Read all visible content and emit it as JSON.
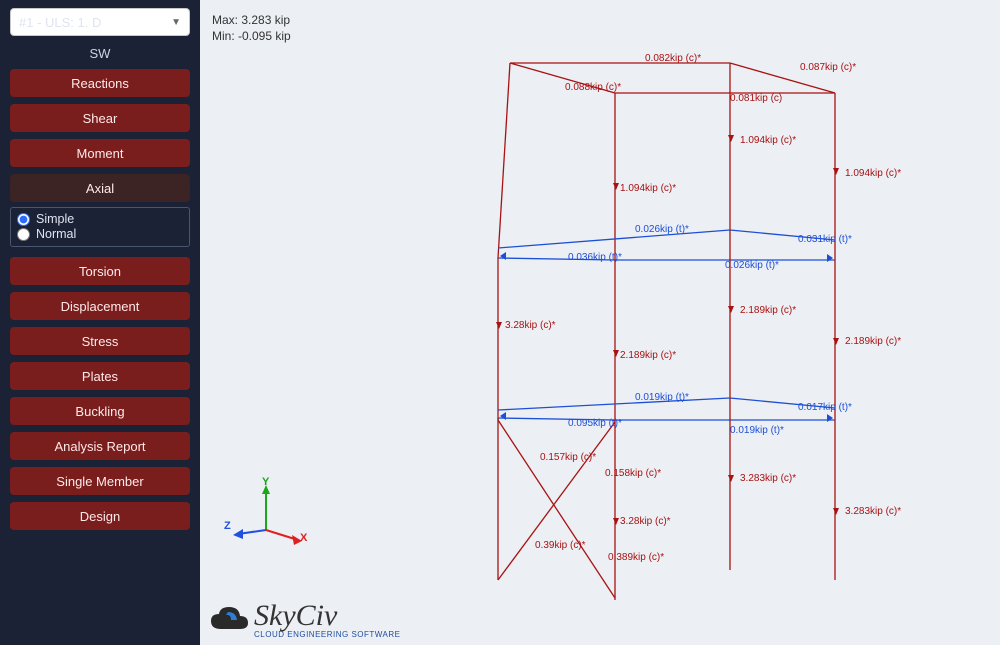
{
  "dropdown": {
    "selected": "#1 - ULS: 1. D"
  },
  "sw_label": "SW",
  "buttons": {
    "reactions": "Reactions",
    "shear": "Shear",
    "moment": "Moment",
    "axial": "Axial",
    "torsion": "Torsion",
    "displacement": "Displacement",
    "stress": "Stress",
    "plates": "Plates",
    "buckling": "Buckling",
    "analysis_report": "Analysis Report",
    "single_member": "Single Member",
    "design": "Design"
  },
  "radio": {
    "simple": "Simple",
    "normal": "Normal"
  },
  "stats": {
    "max": "Max: 3.283 kip",
    "min": "Min: -0.095 kip"
  },
  "axes": {
    "x": "X",
    "y": "Y",
    "z": "Z"
  },
  "brand": {
    "name": "SkyCiv",
    "tagline": "CLOUD ENGINEERING SOFTWARE"
  },
  "annotations": {
    "a0": "0.082kip (c)*",
    "a1": "0.087kip (c)*",
    "a2": "0.088kip (c)*",
    "a3": "0.081kip (c)",
    "a4": "1.094kip (c)*",
    "a5": "1.094kip (c)*",
    "a6": "1.094kip (c)*",
    "a7": "0.026kip (t)*",
    "a8": "0.031kip (t)*",
    "a9": "0.026kip (t)*",
    "a10": "0.036kip (t)*",
    "a11": "2.189kip (c)*",
    "a12": "3.28kip (c)*",
    "a13": "2.189kip (c)*",
    "a14": "2.189kip (c)*",
    "a15": "0.019kip (t)*",
    "a16": "0.017kip (t)*",
    "a17": "0.019kip (t)*",
    "a18": "0.095kip (t)*",
    "a19": "0.157kip (c)*",
    "a20": "0.158kip (c)*",
    "a21": "3.283kip (c)*",
    "a22": "3.28kip (c)*",
    "a23": "3.283kip (c)*",
    "a24": "0.39kip (c)*",
    "a25": "0.389kip (c)*"
  }
}
